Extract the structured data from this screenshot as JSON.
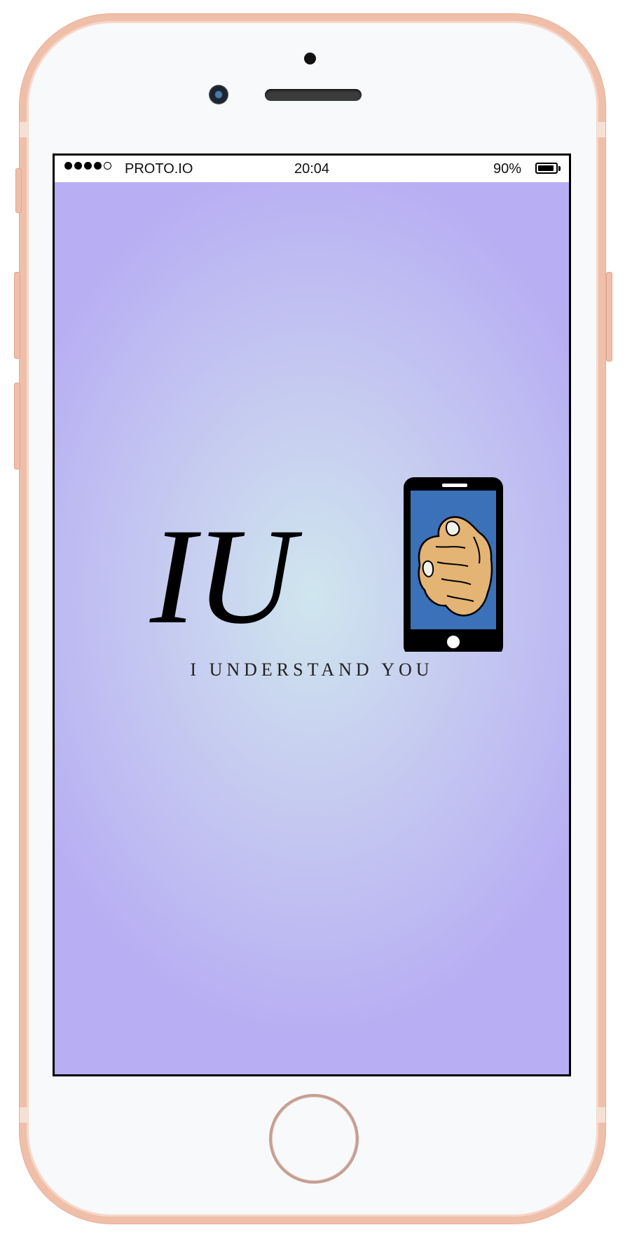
{
  "status_bar": {
    "signal_filled": 4,
    "signal_total": 5,
    "carrier": "PROTO.IO",
    "time": "20:04",
    "battery_percent_label": "90%",
    "battery_level": 0.9
  },
  "splash": {
    "logo_letters": "IU",
    "tagline": "I UNDERSTAND YOU",
    "background_center_color": "#cfe6ee",
    "background_edge_color": "#b8aef3",
    "phone_screen_color": "#3a71b8",
    "hand_color": "#e3b474"
  },
  "device": {
    "frame_color": "#efbfa9",
    "body_color": "#f8f9fb"
  }
}
